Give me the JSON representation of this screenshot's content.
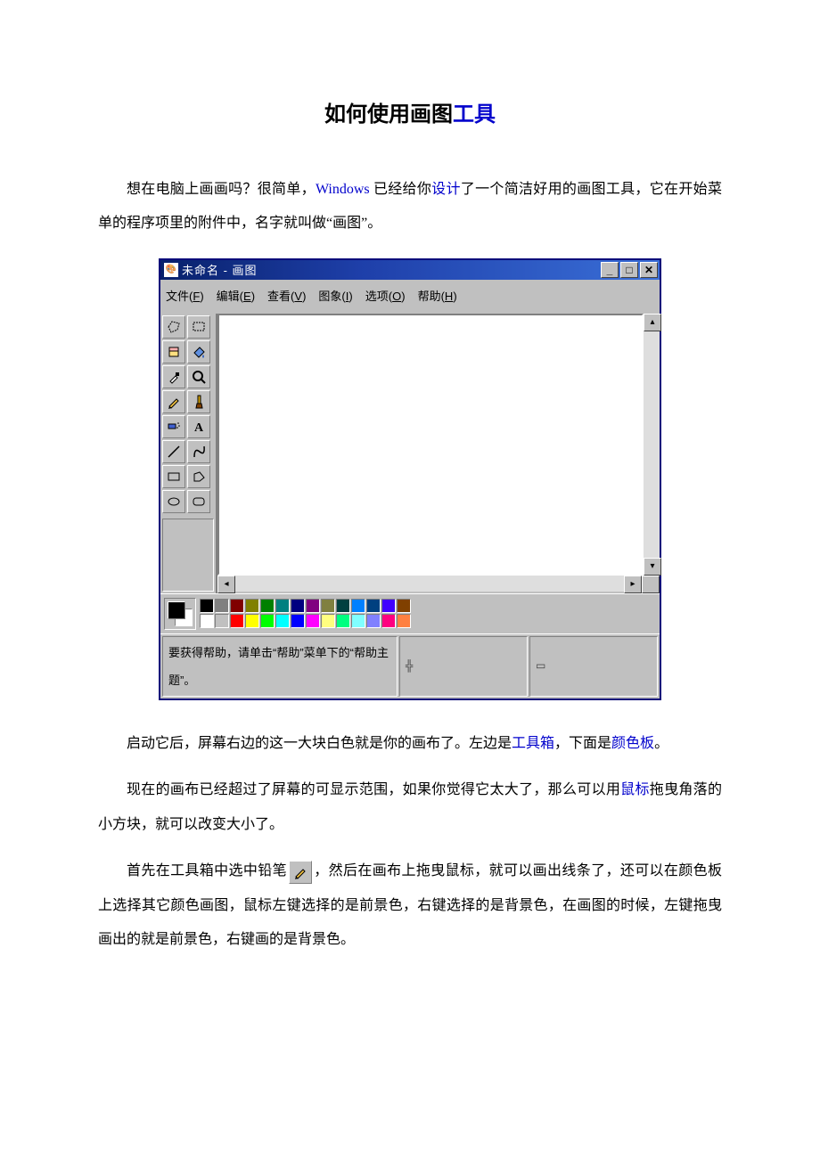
{
  "title": {
    "prefix": "如何使用画图",
    "link": "工具"
  },
  "p1": {
    "a": "想在电脑上画画吗？很简单，",
    "win": "Windows",
    "b": " 已经给你",
    "link": "设计",
    "c": "了一个简洁好用的画图工具，它在开始菜单的程序项里的附件中，名字就叫做“画图”。"
  },
  "p2": {
    "a": "启动它后，屏幕右边的这一大块白色就是你的画布了。左边是",
    "link1": "工具箱",
    "b": "，下面是",
    "link2": "颜色板",
    "c": "。"
  },
  "p3": {
    "a": "现在的画布已经超过了屏幕的可显示范围，如果你觉得它太大了，那么可以用",
    "link": "鼠标",
    "b": "拖曳角落的小方块，就可以改变大小了。"
  },
  "p4": {
    "a": "首先在工具箱中选中铅笔",
    "b": "，然后在画布上拖曳鼠标，就可以画出线条了，还可以在颜色板上选择其它颜色画图，鼠标左键选择的是前景色，右键选择的是背景色，在画图的时候，左键拖曳画出的就是前景色，右键画的是背景色。"
  },
  "paint_window": {
    "title": "未命名 - 画图",
    "menu": {
      "file": {
        "label": "文件",
        "hotkey": "F"
      },
      "edit": {
        "label": "编辑",
        "hotkey": "E"
      },
      "view": {
        "label": "查看",
        "hotkey": "V"
      },
      "image": {
        "label": "图象",
        "hotkey": "I"
      },
      "options": {
        "label": "选项",
        "hotkey": "O"
      },
      "help": {
        "label": "帮助",
        "hotkey": "H"
      }
    },
    "palette": {
      "row1": [
        "#000000",
        "#808080",
        "#800000",
        "#808000",
        "#008000",
        "#008080",
        "#000080",
        "#800080",
        "#808040",
        "#004040",
        "#0080ff",
        "#004080",
        "#4000ff",
        "#804000"
      ],
      "row2": [
        "#ffffff",
        "#c0c0c0",
        "#ff0000",
        "#ffff00",
        "#00ff00",
        "#00ffff",
        "#0000ff",
        "#ff00ff",
        "#ffff80",
        "#00ff80",
        "#80ffff",
        "#8080ff",
        "#ff0080",
        "#ff8040"
      ]
    },
    "status": "要获得帮助，请单击“帮助”菜单下的“帮助主题”。"
  }
}
